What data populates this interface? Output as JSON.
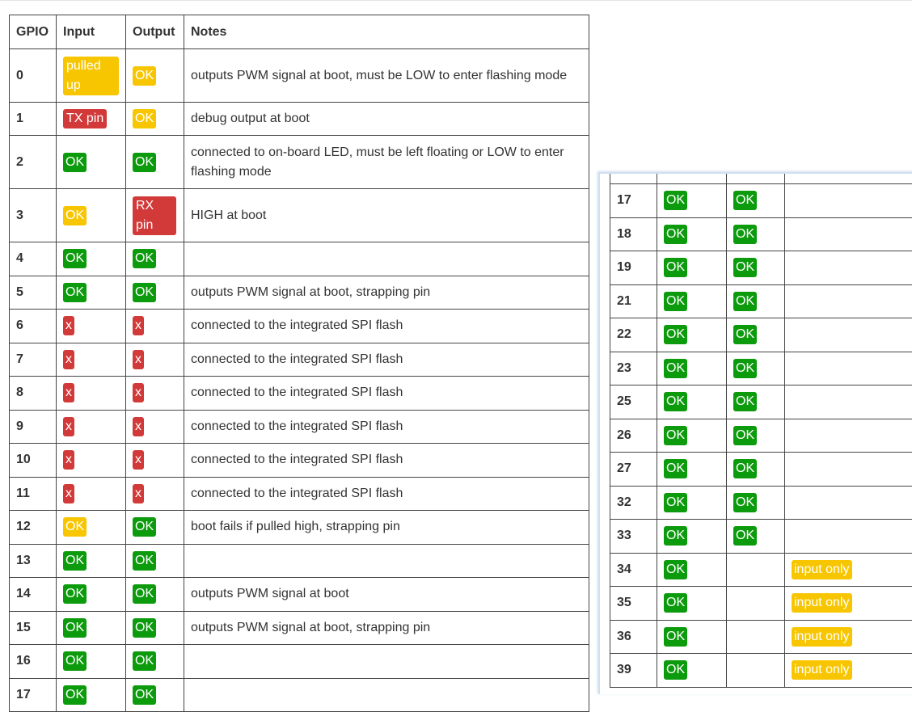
{
  "table": {
    "headers": [
      "GPIO",
      "Input",
      "Output",
      "Notes"
    ],
    "rows": [
      {
        "gpio": "0",
        "input": {
          "text": "pulled up",
          "status": "warn"
        },
        "output": {
          "text": "OK",
          "status": "warn"
        },
        "notes": "outputs PWM signal at boot, must be LOW to enter flashing mode"
      },
      {
        "gpio": "1",
        "input": {
          "text": "TX pin",
          "status": "bad"
        },
        "output": {
          "text": "OK",
          "status": "warn"
        },
        "notes": "debug output at boot"
      },
      {
        "gpio": "2",
        "input": {
          "text": "OK",
          "status": "ok"
        },
        "output": {
          "text": "OK",
          "status": "ok"
        },
        "notes": "connected to on-board LED, must be left floating or LOW to enter flashing mode"
      },
      {
        "gpio": "3",
        "input": {
          "text": "OK",
          "status": "warn"
        },
        "output": {
          "text": "RX pin",
          "status": "bad"
        },
        "notes": "HIGH at boot"
      },
      {
        "gpio": "4",
        "input": {
          "text": "OK",
          "status": "ok"
        },
        "output": {
          "text": "OK",
          "status": "ok"
        },
        "notes": ""
      },
      {
        "gpio": "5",
        "input": {
          "text": "OK",
          "status": "ok"
        },
        "output": {
          "text": "OK",
          "status": "ok"
        },
        "notes": "outputs PWM signal at boot, strapping pin"
      },
      {
        "gpio": "6",
        "input": {
          "text": "x",
          "status": "bad"
        },
        "output": {
          "text": "x",
          "status": "bad"
        },
        "notes": "connected to the integrated SPI flash"
      },
      {
        "gpio": "7",
        "input": {
          "text": "x",
          "status": "bad"
        },
        "output": {
          "text": "x",
          "status": "bad"
        },
        "notes": "connected to the integrated SPI flash"
      },
      {
        "gpio": "8",
        "input": {
          "text": "x",
          "status": "bad"
        },
        "output": {
          "text": "x",
          "status": "bad"
        },
        "notes": "connected to the integrated SPI flash"
      },
      {
        "gpio": "9",
        "input": {
          "text": "x",
          "status": "bad"
        },
        "output": {
          "text": "x",
          "status": "bad"
        },
        "notes": "connected to the integrated SPI flash"
      },
      {
        "gpio": "10",
        "input": {
          "text": "x",
          "status": "bad"
        },
        "output": {
          "text": "x",
          "status": "bad"
        },
        "notes": "connected to the integrated SPI flash"
      },
      {
        "gpio": "11",
        "input": {
          "text": "x",
          "status": "bad"
        },
        "output": {
          "text": "x",
          "status": "bad"
        },
        "notes": "connected to the integrated SPI flash"
      },
      {
        "gpio": "12",
        "input": {
          "text": "OK",
          "status": "warn"
        },
        "output": {
          "text": "OK",
          "status": "ok"
        },
        "notes": "boot fails if pulled high, strapping pin"
      },
      {
        "gpio": "13",
        "input": {
          "text": "OK",
          "status": "ok"
        },
        "output": {
          "text": "OK",
          "status": "ok"
        },
        "notes": ""
      },
      {
        "gpio": "14",
        "input": {
          "text": "OK",
          "status": "ok"
        },
        "output": {
          "text": "OK",
          "status": "ok"
        },
        "notes": "outputs PWM signal at boot"
      },
      {
        "gpio": "15",
        "input": {
          "text": "OK",
          "status": "ok"
        },
        "output": {
          "text": "OK",
          "status": "ok"
        },
        "notes": "outputs PWM signal at boot, strapping pin"
      },
      {
        "gpio": "16",
        "input": {
          "text": "OK",
          "status": "ok"
        },
        "output": {
          "text": "OK",
          "status": "ok"
        },
        "notes": ""
      },
      {
        "gpio": "17",
        "input": {
          "text": "OK",
          "status": "ok"
        },
        "output": {
          "text": "OK",
          "status": "ok"
        },
        "notes": ""
      }
    ]
  },
  "overlay": {
    "rows": [
      {
        "gpio": "17",
        "input": {
          "text": "OK",
          "status": "ok"
        },
        "output": {
          "text": "OK",
          "status": "ok"
        },
        "notes": null
      },
      {
        "gpio": "18",
        "input": {
          "text": "OK",
          "status": "ok"
        },
        "output": {
          "text": "OK",
          "status": "ok"
        },
        "notes": null
      },
      {
        "gpio": "19",
        "input": {
          "text": "OK",
          "status": "ok"
        },
        "output": {
          "text": "OK",
          "status": "ok"
        },
        "notes": null
      },
      {
        "gpio": "21",
        "input": {
          "text": "OK",
          "status": "ok"
        },
        "output": {
          "text": "OK",
          "status": "ok"
        },
        "notes": null
      },
      {
        "gpio": "22",
        "input": {
          "text": "OK",
          "status": "ok"
        },
        "output": {
          "text": "OK",
          "status": "ok"
        },
        "notes": null
      },
      {
        "gpio": "23",
        "input": {
          "text": "OK",
          "status": "ok"
        },
        "output": {
          "text": "OK",
          "status": "ok"
        },
        "notes": null
      },
      {
        "gpio": "25",
        "input": {
          "text": "OK",
          "status": "ok"
        },
        "output": {
          "text": "OK",
          "status": "ok"
        },
        "notes": null
      },
      {
        "gpio": "26",
        "input": {
          "text": "OK",
          "status": "ok"
        },
        "output": {
          "text": "OK",
          "status": "ok"
        },
        "notes": null
      },
      {
        "gpio": "27",
        "input": {
          "text": "OK",
          "status": "ok"
        },
        "output": {
          "text": "OK",
          "status": "ok"
        },
        "notes": null
      },
      {
        "gpio": "32",
        "input": {
          "text": "OK",
          "status": "ok"
        },
        "output": {
          "text": "OK",
          "status": "ok"
        },
        "notes": null
      },
      {
        "gpio": "33",
        "input": {
          "text": "OK",
          "status": "ok"
        },
        "output": {
          "text": "OK",
          "status": "ok"
        },
        "notes": null
      },
      {
        "gpio": "34",
        "input": {
          "text": "OK",
          "status": "ok"
        },
        "output": null,
        "notes": {
          "text": "input only",
          "status": "warn"
        }
      },
      {
        "gpio": "35",
        "input": {
          "text": "OK",
          "status": "ok"
        },
        "output": null,
        "notes": {
          "text": "input only",
          "status": "warn"
        }
      },
      {
        "gpio": "36",
        "input": {
          "text": "OK",
          "status": "ok"
        },
        "output": null,
        "notes": {
          "text": "input only",
          "status": "warn"
        }
      },
      {
        "gpio": "39",
        "input": {
          "text": "OK",
          "status": "ok"
        },
        "output": null,
        "notes": {
          "text": "input only",
          "status": "warn"
        }
      }
    ]
  },
  "colors": {
    "ok": "#0c9b0c",
    "warn": "#f7c600",
    "bad": "#d23a3a",
    "border": "#444444",
    "overlay_border": "#cfe0f2"
  }
}
